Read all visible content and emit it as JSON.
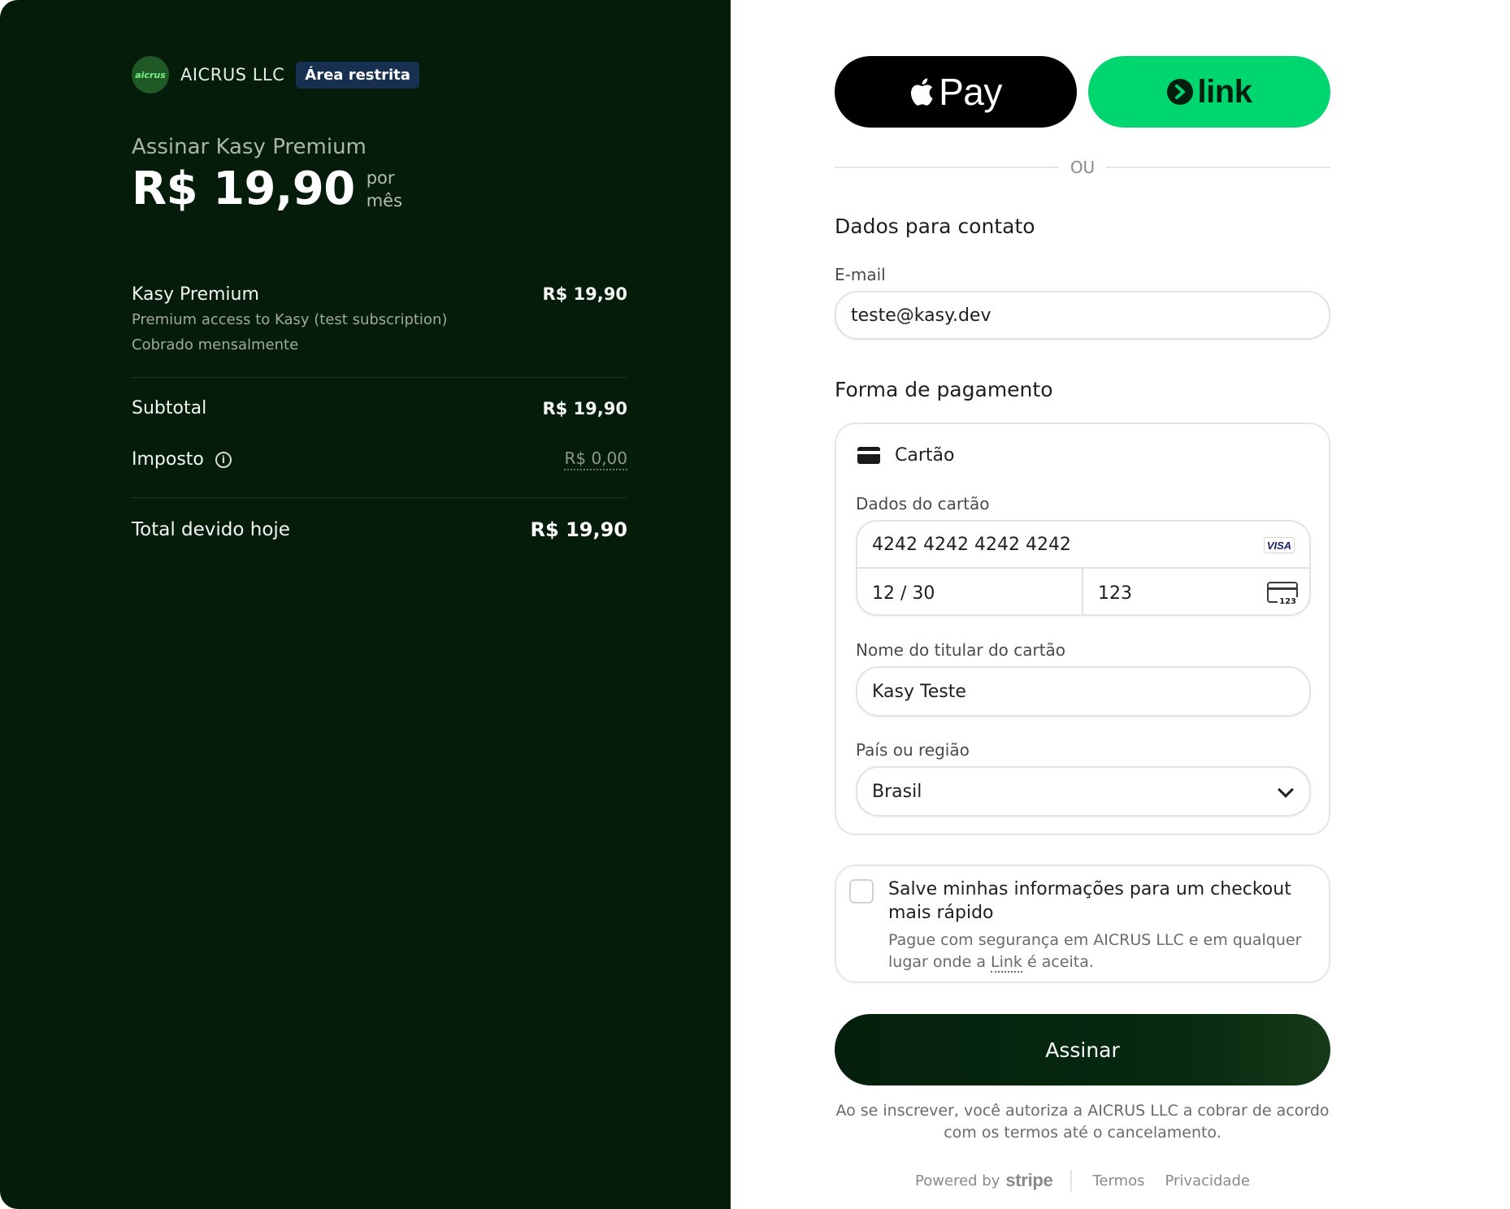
{
  "merchant": {
    "logo_text": "aicrus",
    "name": "AICRUS LLC",
    "badge": "Área restrita"
  },
  "summary": {
    "title": "Assinar Kasy Premium",
    "price": "R$ 19,90",
    "period_line1": "por",
    "period_line2": "mês",
    "line_item": {
      "name": "Kasy Premium",
      "price": "R$ 19,90",
      "description": "Premium access to Kasy (test subscription)",
      "billing": "Cobrado mensalmente"
    },
    "subtotal_label": "Subtotal",
    "subtotal_value": "R$ 19,90",
    "tax_label": "Imposto",
    "tax_value": "R$ 0,00",
    "total_label": "Total devido hoje",
    "total_value": "R$ 19,90"
  },
  "wallets": {
    "apple_pay_label": "Pay",
    "link_label": "link",
    "separator": "OU"
  },
  "contact": {
    "section_title": "Dados para contato",
    "email_label": "E-mail",
    "email_value": "teste@kasy.dev"
  },
  "payment": {
    "section_title": "Forma de pagamento",
    "method_label": "Cartão",
    "card_details_label": "Dados do cartão",
    "card_number": "4242 4242 4242 4242",
    "card_brand": "VISA",
    "expiry": "12 / 30",
    "cvc": "123",
    "cvc_icon_text": "123",
    "cardholder_label": "Nome do titular do cartão",
    "cardholder_value": "Kasy Teste",
    "country_label": "País ou região",
    "country_value": "Brasil"
  },
  "save_info": {
    "checked": false,
    "title": "Salve minhas informações para um checkout mais rápido",
    "desc_before": "Pague com segurança em AICRUS LLC e em qualquer lugar onde a ",
    "desc_link": "Link",
    "desc_after": " é aceita."
  },
  "submit_label": "Assinar",
  "legal_text": "Ao se inscrever, você autoriza a AICRUS LLC a cobrar de acordo com os termos até o cancelamento.",
  "footer": {
    "powered_by": "Powered by",
    "stripe": "stripe",
    "terms": "Termos",
    "privacy": "Privacidade"
  },
  "colors": {
    "left_background": "#061c0a",
    "link_green": "#00d66f",
    "submit_background": "#04200c",
    "badge_background": "#17304f"
  }
}
